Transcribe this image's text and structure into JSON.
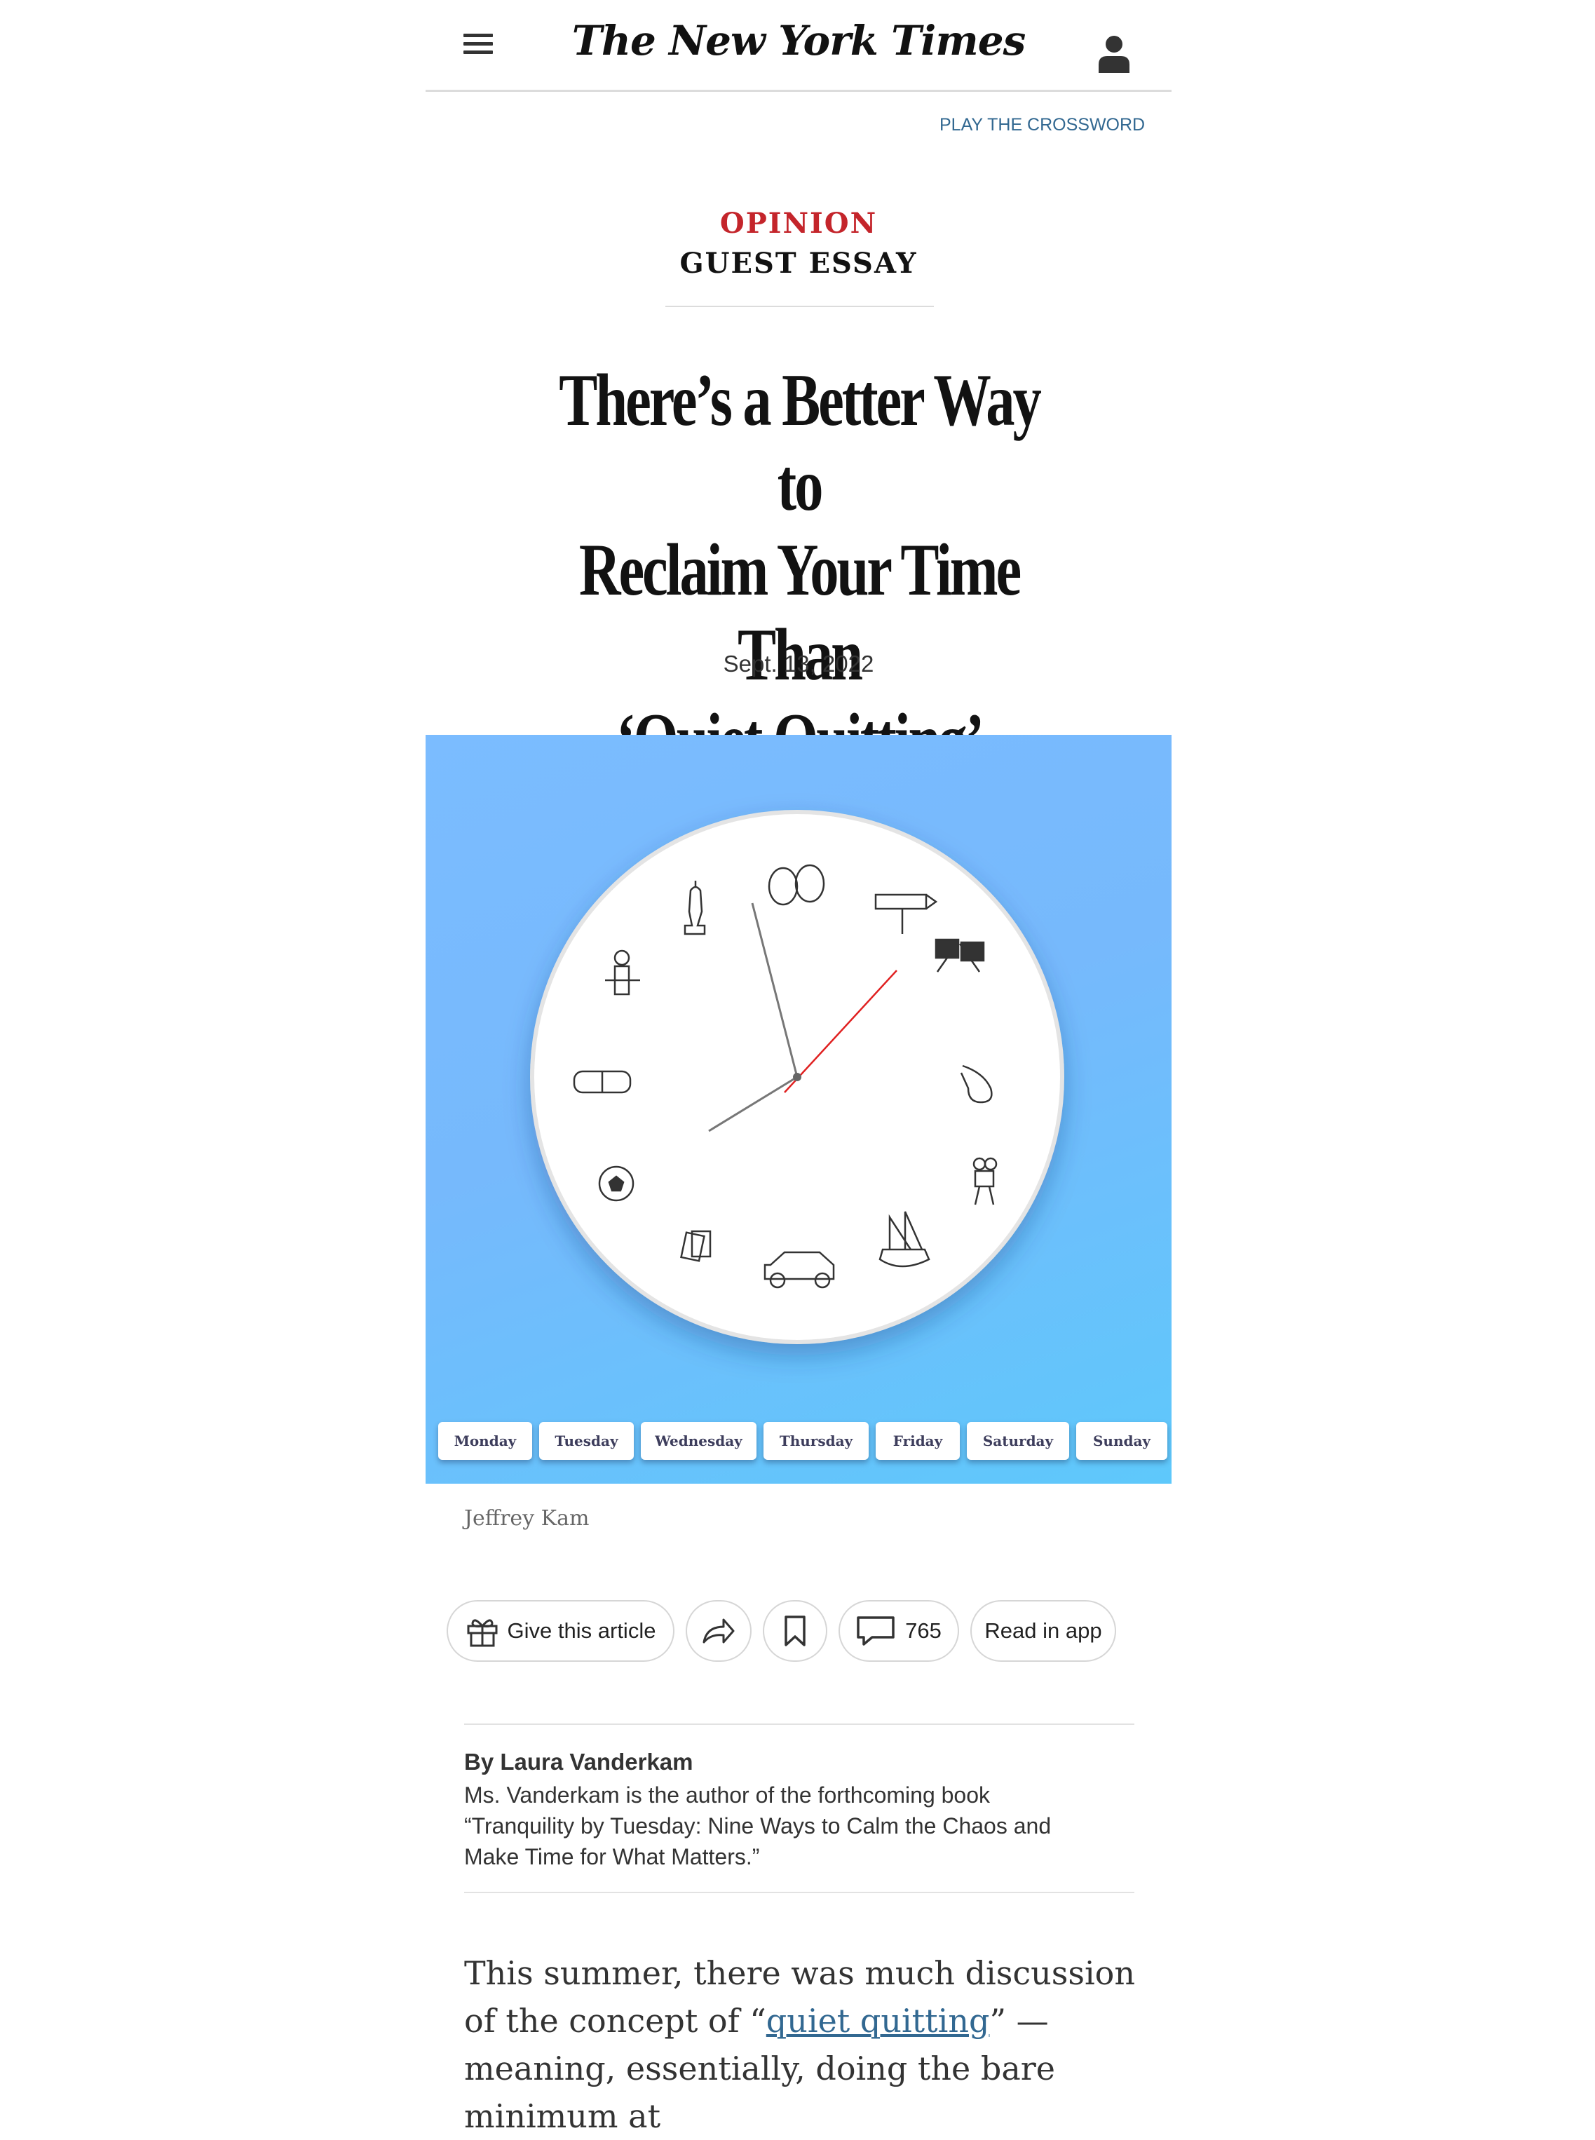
{
  "header": {
    "logo": "The New York Times",
    "menu_icon": "hamburger-menu-icon",
    "account_icon": "account-icon"
  },
  "top_link": "PLAY THE CROSSWORD",
  "section": {
    "opinion": "OPINION",
    "type": "GUEST ESSAY"
  },
  "headline": {
    "line1": "There’s a Better Way to",
    "line2": "Reclaim Your Time Than",
    "line3": "‘Quiet Quitting’"
  },
  "date": "Sept. 13, 2022",
  "illustration": {
    "days": [
      "Monday",
      "Tuesday",
      "Wednesday",
      "Thursday",
      "Friday",
      "Saturday",
      "Sunday"
    ],
    "colors": {
      "background": "#78bbfd",
      "second_hand": "#e02020"
    }
  },
  "credit": "Jeffrey Kam",
  "toolbar": {
    "give_label": "Give this article",
    "comments_count": "765",
    "read_in_app_label": "Read in app"
  },
  "byline": {
    "author": "By Laura Vanderkam",
    "bio": "Ms. Vanderkam is the author of the forthcoming book “Tranquility by Tuesday: Nine Ways to Calm the Chaos and Make Time for What Matters.”"
  },
  "body": {
    "before_link": "This summer, there was much discussion of the concept of “",
    "link_text": "quiet quitting",
    "after_link": "” — meaning, essentially, doing the bare minimum at"
  },
  "colors": {
    "accent_red": "#c4252b",
    "link_blue": "#326891"
  }
}
